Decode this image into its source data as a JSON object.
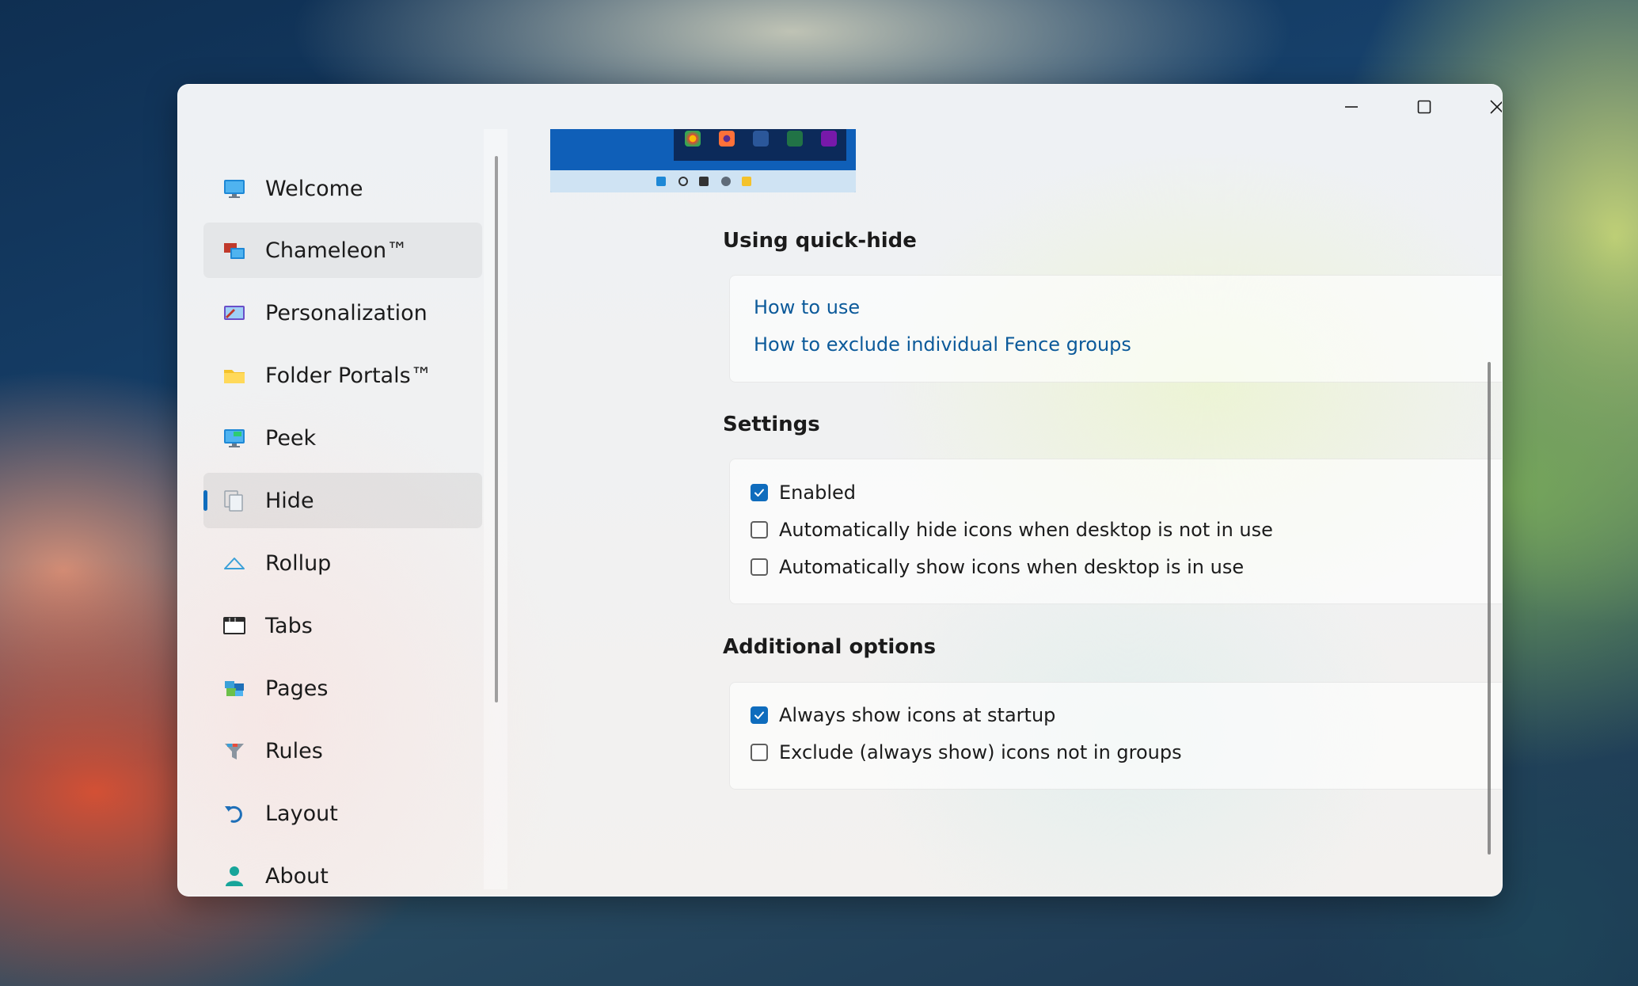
{
  "window_controls": {
    "minimize_icon": "minimize-icon",
    "maximize_icon": "maximize-icon",
    "close_icon": "close-icon"
  },
  "sidebar": {
    "items": [
      {
        "label": "Welcome",
        "icon": "monitor-icon"
      },
      {
        "label": "Chameleon™",
        "icon": "chameleon-icon"
      },
      {
        "label": "Personalization",
        "icon": "personalization-icon"
      },
      {
        "label": "Folder Portals™",
        "icon": "folder-icon"
      },
      {
        "label": "Peek",
        "icon": "peek-icon"
      },
      {
        "label": "Hide",
        "icon": "hide-icon"
      },
      {
        "label": "Rollup",
        "icon": "rollup-icon"
      },
      {
        "label": "Tabs",
        "icon": "tabs-icon"
      },
      {
        "label": "Pages",
        "icon": "pages-icon"
      },
      {
        "label": "Rules",
        "icon": "rules-icon"
      },
      {
        "label": "Layout",
        "icon": "layout-icon"
      },
      {
        "label": "About",
        "icon": "about-icon"
      }
    ],
    "selected": "Hide",
    "accent": "#0f6cbd"
  },
  "content": {
    "quick_hide": {
      "title": "Using quick-hide",
      "links": [
        "How to use",
        "How to exclude individual Fence groups"
      ]
    },
    "settings": {
      "title": "Settings",
      "options": [
        {
          "label": "Enabled",
          "checked": true
        },
        {
          "label": "Automatically hide icons when desktop is not in use",
          "checked": false
        },
        {
          "label": "Automatically show icons when desktop is in use",
          "checked": false
        }
      ]
    },
    "additional": {
      "title": "Additional options",
      "options": [
        {
          "label": "Always show icons at startup",
          "checked": true
        },
        {
          "label": "Exclude (always show) icons not in groups",
          "checked": false
        }
      ]
    }
  }
}
